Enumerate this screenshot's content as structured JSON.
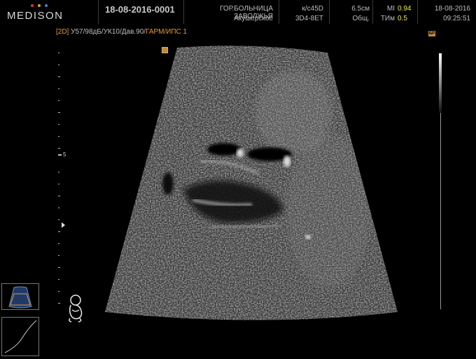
{
  "header": {
    "logo": "MEDISON",
    "logo_dot_colors": [
      "#d63a2a",
      "#e0a02a",
      "#3a8ad6"
    ],
    "patient_id": "18-08-2016-0001",
    "hospital": "ГОР.БОЛЬНИЦА ЗАВОЛЖЬЯ",
    "preset": "Акушерское",
    "probe_freq": "к/с45D",
    "probe_model": "3D4-8ET",
    "depth": "6.5см",
    "mode_general": "Общ.",
    "mi_label": "MI",
    "mi_value": "0.94",
    "ti_label": "ТИм",
    "ti_value": "0.5",
    "date": "18-08-2016",
    "time": "09:25:51"
  },
  "params": {
    "mode": "[2D]",
    "settings": "У57/98дБ/УК10/Дав.90/",
    "harmonic": "ГАРМ/ИПС 1"
  },
  "depth_scale": {
    "label": "5"
  },
  "markers": {
    "top_right": "БР"
  },
  "colors": {
    "accent_orange": "#e39a3a",
    "index_yellow": "#e8e84a",
    "marker_brown": "#c08a3a"
  }
}
